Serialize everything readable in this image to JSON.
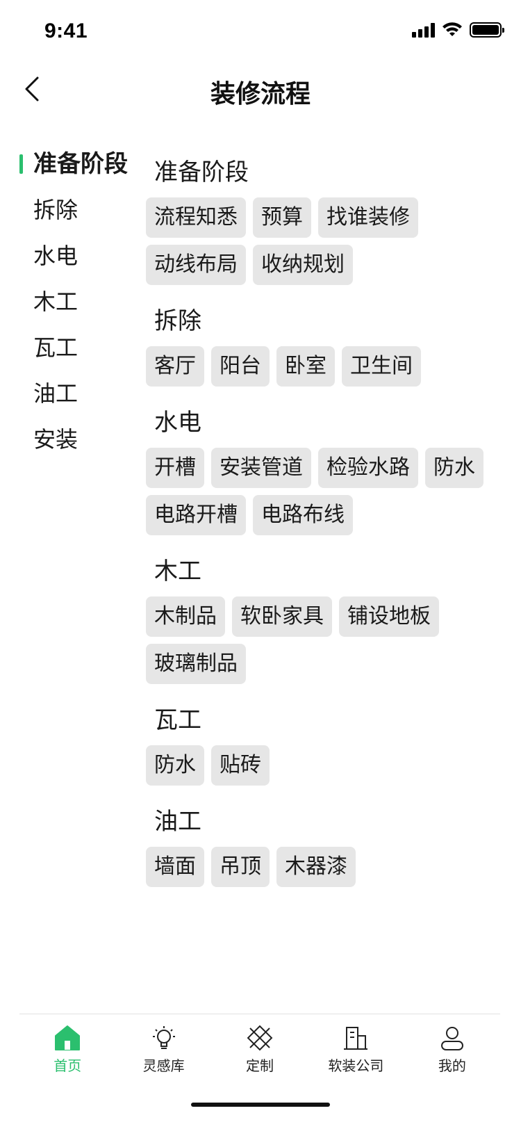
{
  "status": {
    "time": "9:41"
  },
  "nav": {
    "title": "装修流程"
  },
  "stages": [
    {
      "label": "准备阶段",
      "active": true
    },
    {
      "label": "拆除"
    },
    {
      "label": "水电"
    },
    {
      "label": "木工"
    },
    {
      "label": "瓦工"
    },
    {
      "label": "油工"
    },
    {
      "label": "安装"
    }
  ],
  "sections": [
    {
      "title": "准备阶段",
      "tags": [
        "流程知悉",
        "预算",
        "找谁装修",
        "动线布局",
        "收纳规划"
      ]
    },
    {
      "title": "拆除",
      "tags": [
        "客厅",
        "阳台",
        "卧室",
        "卫生间"
      ]
    },
    {
      "title": "水电",
      "tags": [
        "开槽",
        "安装管道",
        "检验水路",
        "防水",
        "电路开槽",
        "电路布线"
      ]
    },
    {
      "title": "木工",
      "tags": [
        "木制品",
        "软卧家具",
        "铺设地板",
        "玻璃制品"
      ]
    },
    {
      "title": "瓦工",
      "tags": [
        "防水",
        "贴砖"
      ]
    },
    {
      "title": "油工",
      "tags": [
        "墙面",
        "吊顶",
        "木器漆"
      ]
    }
  ],
  "tabbar": [
    {
      "label": "首页",
      "icon": "home-icon",
      "active": true
    },
    {
      "label": "灵感库",
      "icon": "lightbulb-icon"
    },
    {
      "label": "定制",
      "icon": "custom-icon"
    },
    {
      "label": "软装公司",
      "icon": "building-icon"
    },
    {
      "label": "我的",
      "icon": "user-icon"
    }
  ],
  "colors": {
    "accent": "#2bbf6e",
    "tag_bg": "#e6e6e6"
  }
}
